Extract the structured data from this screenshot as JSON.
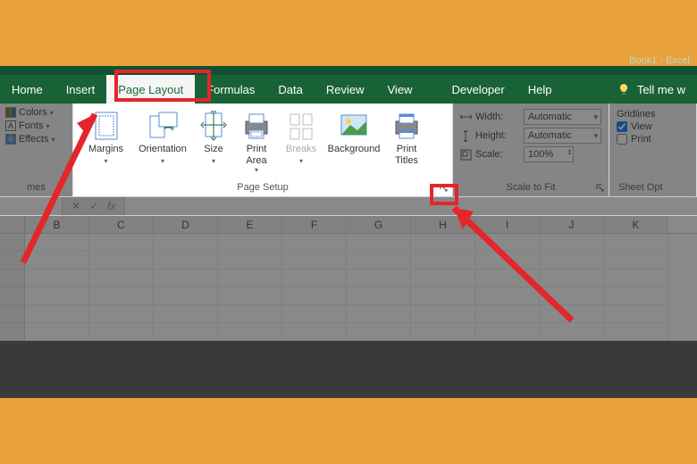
{
  "title": "Book1 - Excel",
  "tabs": {
    "home": "Home",
    "insert": "Insert",
    "page_layout": "Page Layout",
    "formulas": "Formulas",
    "data": "Data",
    "review": "Review",
    "view": "View",
    "developer": "Developer",
    "help": "Help",
    "tell_me": "Tell me w"
  },
  "themes": {
    "colors": "Colors",
    "fonts": "Fonts",
    "effects": "Effects",
    "group_label": "mes"
  },
  "page_setup": {
    "margins": "Margins",
    "orientation": "Orientation",
    "size": "Size",
    "print_area": "Print\nArea",
    "breaks": "Breaks",
    "background": "Background",
    "print_titles": "Print\nTitles",
    "group_label": "Page Setup"
  },
  "scale": {
    "width_label": "Width:",
    "height_label": "Height:",
    "scale_label": "Scale:",
    "width_value": "Automatic",
    "height_value": "Automatic",
    "scale_value": "100%",
    "group_label": "Scale to Fit"
  },
  "sheet_options": {
    "gridlines": "Gridlines",
    "view": "View",
    "print": "Print",
    "group_label": "Sheet Opt"
  },
  "formula_bar": {
    "namebox": "",
    "fx": "fx"
  },
  "columns": [
    "B",
    "C",
    "D",
    "E",
    "F",
    "G",
    "H",
    "I",
    "J",
    "K"
  ],
  "rows": [
    "",
    "",
    "",
    "",
    "",
    ""
  ]
}
